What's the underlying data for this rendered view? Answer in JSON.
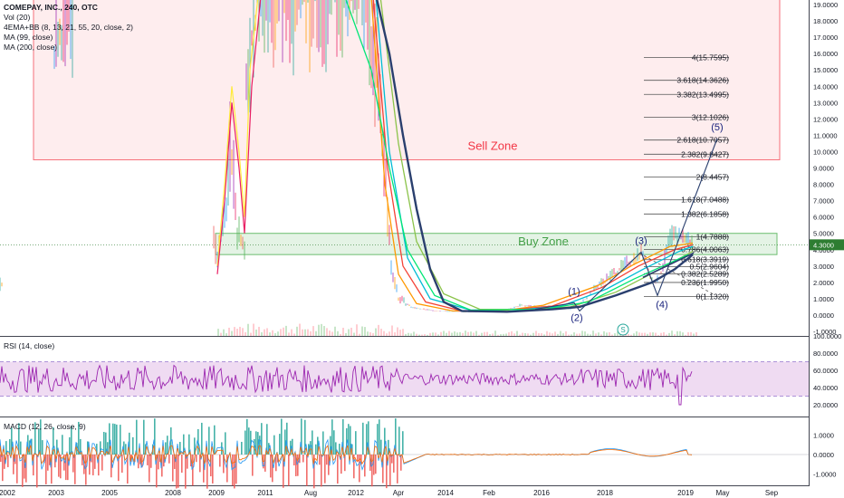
{
  "header": {
    "symbol": "COMEPAY, INC., 240, OTC",
    "indicators": [
      "Vol (20)",
      "4EMA+BB (8, 13, 21, 55, 20, close, 2)",
      "MA (99, close)",
      "MA (200, close)"
    ]
  },
  "rsi_label": "RSI (14, close)",
  "macd_label": "MACD (12, 26, close, 9)",
  "colors": {
    "sell_zone": "#f23645",
    "buy_zone": "#4caf50",
    "rsi_line": "#9c27b0",
    "rsi_band": "#e1bee7",
    "ma200": "#2a3f6e",
    "price_badge": "#2e7d32",
    "axis_text": "#131722",
    "grid": "#d1d4dc"
  },
  "chart_data": [
    {
      "type": "line",
      "pane": "price",
      "zones": [
        {
          "label": "Sell Zone",
          "y_range": [
            9.5,
            20.0
          ],
          "x_range": [
            "2002",
            "2019+"
          ]
        },
        {
          "label": "Buy Zone",
          "y_range": [
            3.7,
            5.0
          ],
          "x_range": [
            "2009",
            "2019+"
          ]
        }
      ],
      "fib_levels": [
        {
          "label": "4(15.7595)",
          "value": 15.7595
        },
        {
          "label": "3.618(14.3626)",
          "value": 14.3626
        },
        {
          "label": "3.382(13.4995)",
          "value": 13.4995
        },
        {
          "label": "3(12.1026)",
          "value": 12.1026
        },
        {
          "label": "2.618(10.7057)",
          "value": 10.7057
        },
        {
          "label": "2.382(9.8427)",
          "value": 9.8427
        },
        {
          "label": "2(8.4457)",
          "value": 8.4457
        },
        {
          "label": "1.618(7.0488)",
          "value": 7.0488
        },
        {
          "label": "1.382(6.1858)",
          "value": 6.1858
        },
        {
          "label": "1(4.7888)",
          "value": 4.7888
        },
        {
          "label": "0.786(4.0063)",
          "value": 4.0063
        },
        {
          "label": "0.618(3.3919)",
          "value": 3.3919
        },
        {
          "label": "0.5(2.9604)",
          "value": 2.9604
        },
        {
          "label": "0.382(2.5289)",
          "value": 2.5289
        },
        {
          "label": "0.236(1.9950)",
          "value": 1.995
        },
        {
          "label": "0(1.1320)",
          "value": 1.132
        }
      ],
      "wave_labels": [
        {
          "label": "(1)",
          "x": "2017",
          "y": 0.65
        },
        {
          "label": "(2)",
          "x": "2017",
          "y": 0.25
        },
        {
          "label": "(3)",
          "x": "2018",
          "y": 4.1
        },
        {
          "label": "(4)",
          "x": "2018",
          "y": 1.3
        },
        {
          "label": "(5)",
          "x": "2019",
          "y": 11.0
        }
      ],
      "last_price": "4.3000",
      "y_ticks": [
        "19.0000",
        "18.0000",
        "17.0000",
        "16.0000",
        "15.0000",
        "14.0000",
        "13.0000",
        "12.0000",
        "11.0000",
        "10.0000",
        "9.0000",
        "8.0000",
        "7.0000",
        "6.0000",
        "5.0000",
        "4.0000",
        "3.0000",
        "2.0000",
        "1.0000",
        "0.0000",
        "-1.0000"
      ],
      "ylim": [
        -1.0,
        19.6
      ],
      "series": [
        {
          "values": [
            1.8,
            6.0,
            15.0,
            20.0,
            13.0,
            4.0,
            1.0,
            0.3,
            0.15,
            0.2,
            0.5,
            0.8,
            1.5,
            2.8,
            3.8,
            4.7,
            4.3
          ]
        },
        {
          "name": "MA (200, close)",
          "values": [
            19.5,
            18.0,
            12.0,
            6.0,
            2.0,
            0.3,
            0.15,
            0.2,
            0.4,
            0.6,
            1.6,
            2.2,
            3.0,
            3.7
          ]
        }
      ]
    },
    {
      "type": "line",
      "pane": "rsi",
      "y_ticks": [
        "100.0000",
        "80.0000",
        "60.0000",
        "40.0000",
        "20.0000"
      ],
      "ylim": [
        10,
        102
      ],
      "band": [
        30,
        70
      ]
    },
    {
      "type": "bar",
      "pane": "macd",
      "y_ticks": [
        "1.0000",
        "0.0000",
        "-1.0000"
      ],
      "ylim": [
        -1.8,
        1.6
      ]
    }
  ],
  "x_axis": {
    "labels": [
      "2002",
      "2003",
      "2005",
      "2008",
      "2009",
      "2011",
      "Aug",
      "2012",
      "Apr",
      "2014",
      "Feb",
      "2016",
      "2018",
      "2019",
      "May",
      "Sep"
    ]
  }
}
